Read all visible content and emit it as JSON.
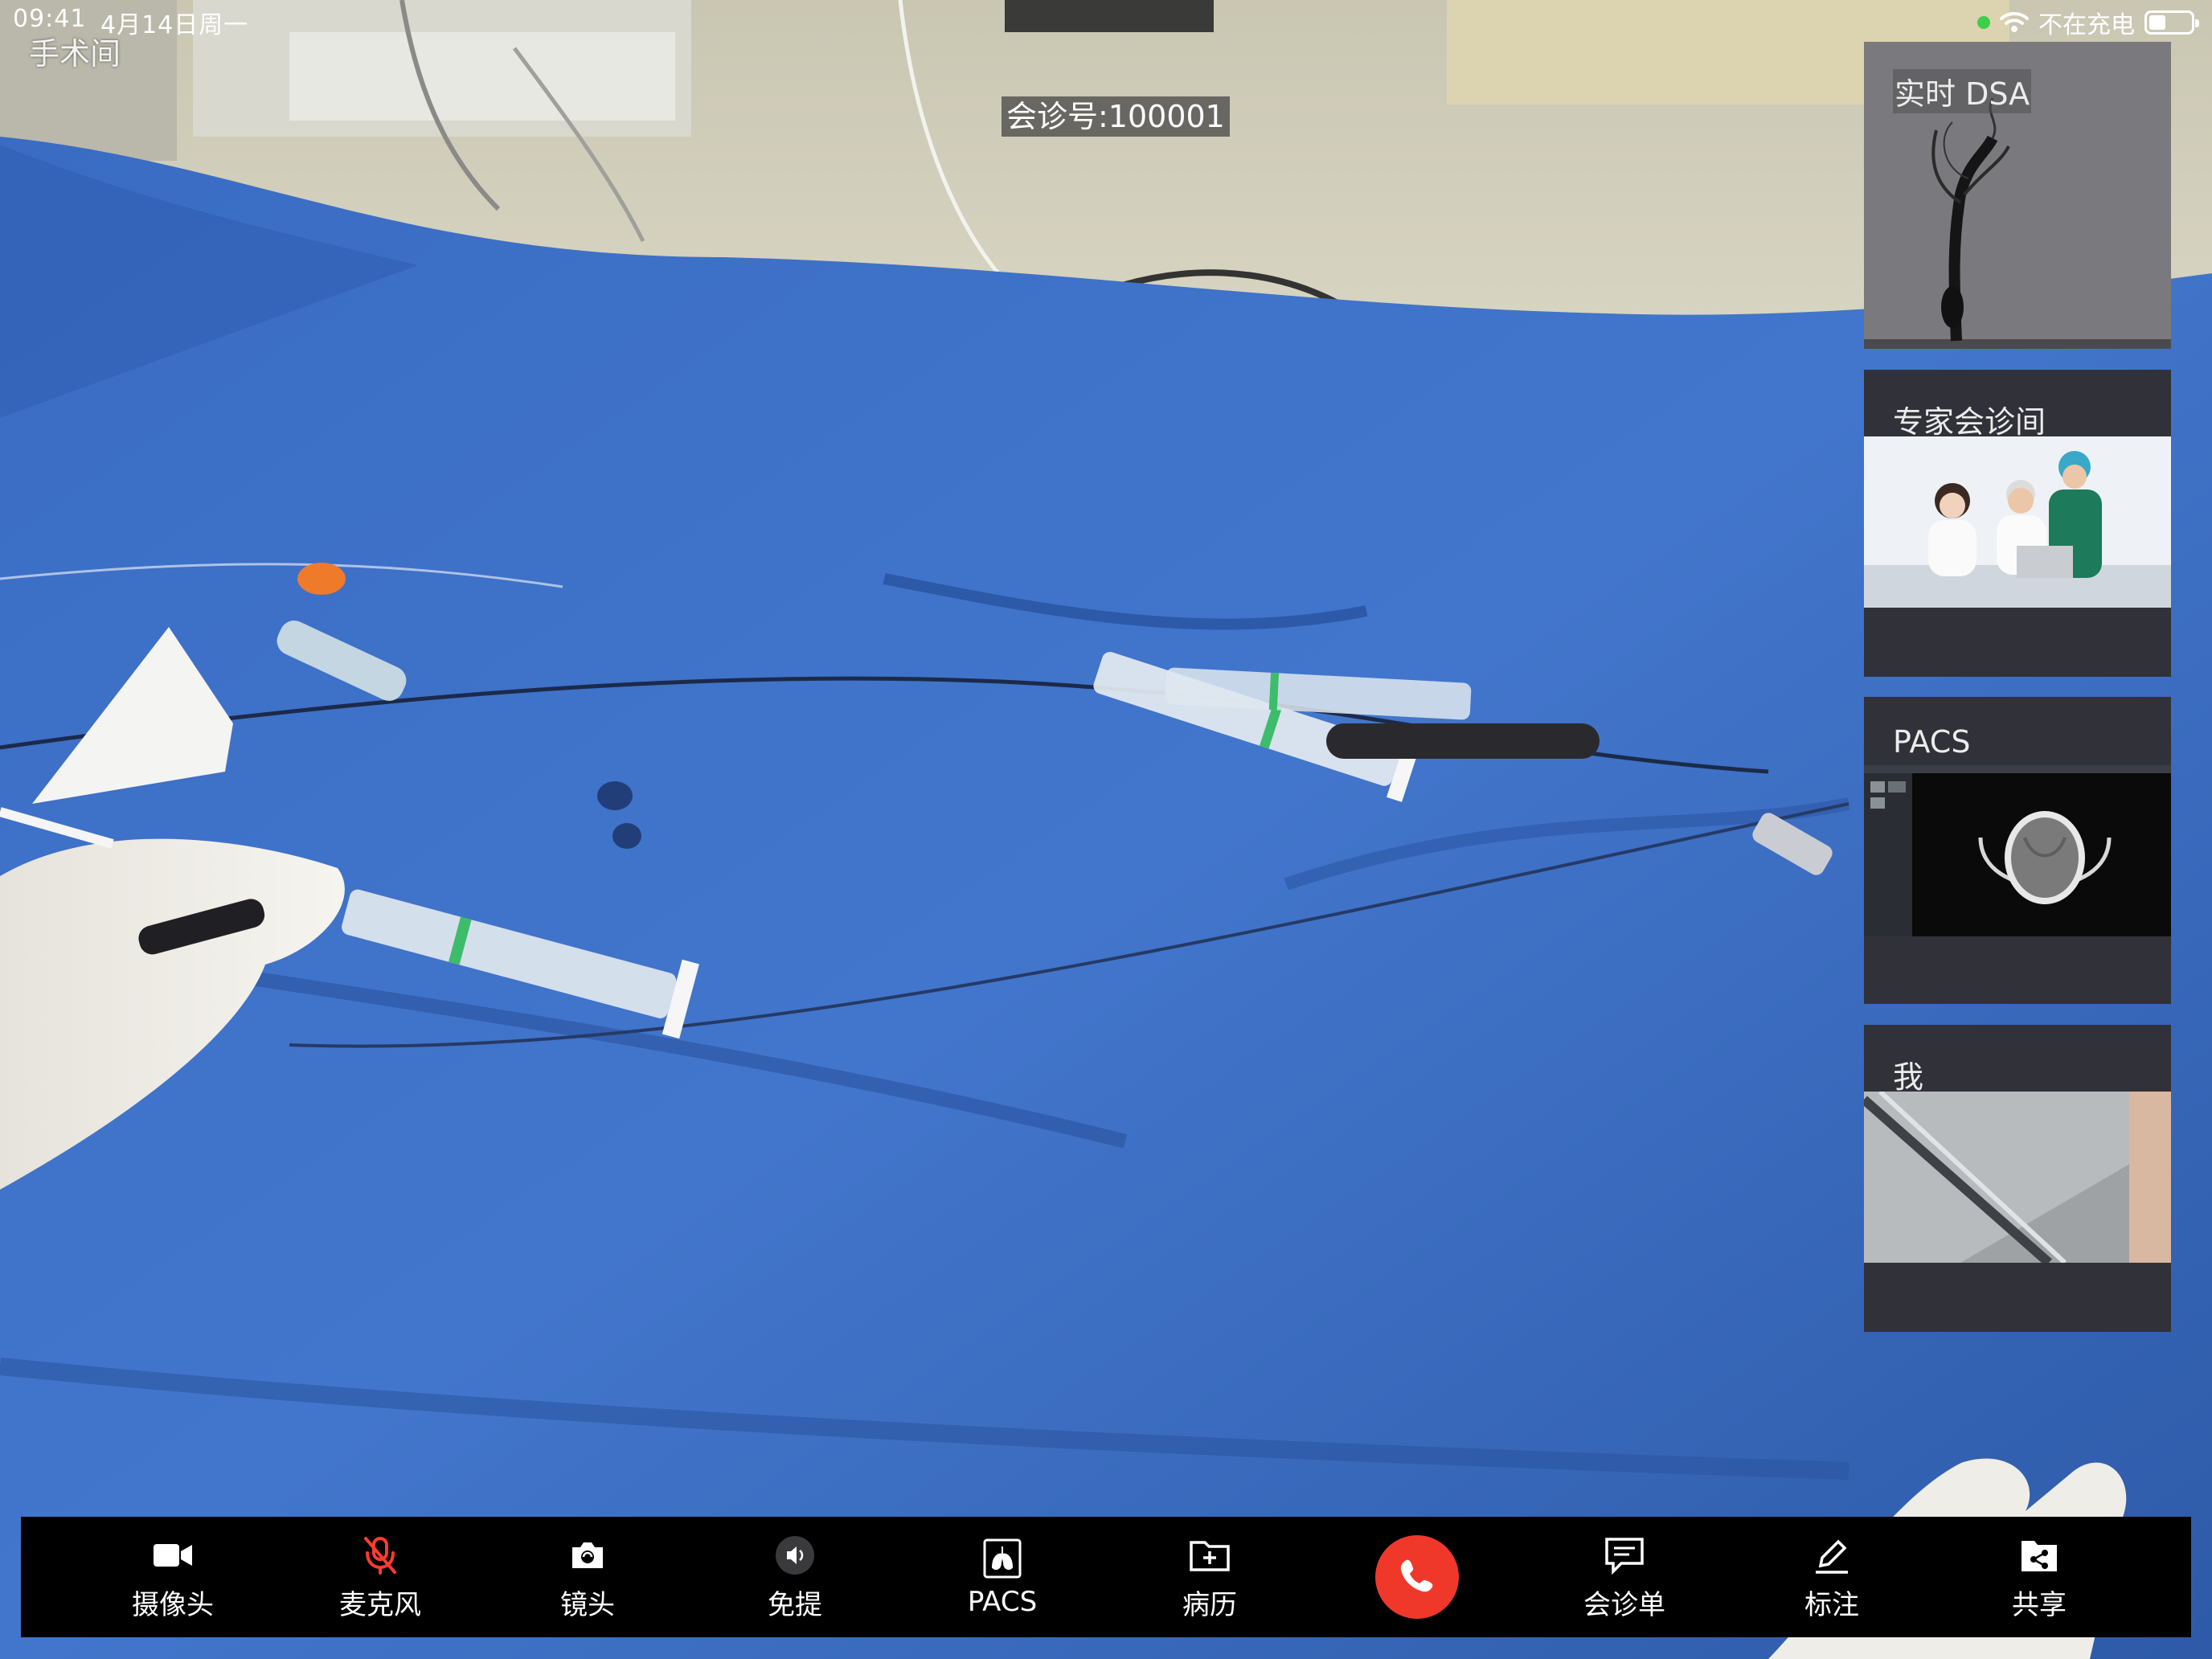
{
  "status_bar": {
    "time": "09:41",
    "date": "4月14日周一",
    "charging_status": "不在充电",
    "indicator_color": "#3ccf4e",
    "icons": [
      "wifi-icon",
      "battery-icon"
    ]
  },
  "main_video": {
    "room_label": "手术间",
    "consult_id": "会诊号:100001"
  },
  "side_panels": [
    {
      "title": "实时 DSA",
      "media": "dsa-angiography-image"
    },
    {
      "title": "专家会诊间",
      "media": "expert-doctors-video"
    },
    {
      "title": "PACS",
      "media": "pacs-ct-viewer"
    },
    {
      "title": "我",
      "media": "self-camera-video"
    }
  ],
  "toolbar": {
    "camera": "摄像头",
    "microphone": "麦克风",
    "lens": "镜头",
    "speaker": "免提",
    "pacs": "PACS",
    "records": "病历",
    "consult_form": "会诊单",
    "annotate": "标注",
    "share": "共享",
    "hangup_color": "#f0382a",
    "muted_color": "#ff3b30",
    "icons": [
      "video-camera-icon",
      "mic-off-icon",
      "camera-switch-icon",
      "speaker-icon",
      "lungs-icon",
      "folder-add-icon",
      "phone-icon",
      "chat-icon",
      "pencil-icon",
      "share-folder-icon"
    ]
  }
}
